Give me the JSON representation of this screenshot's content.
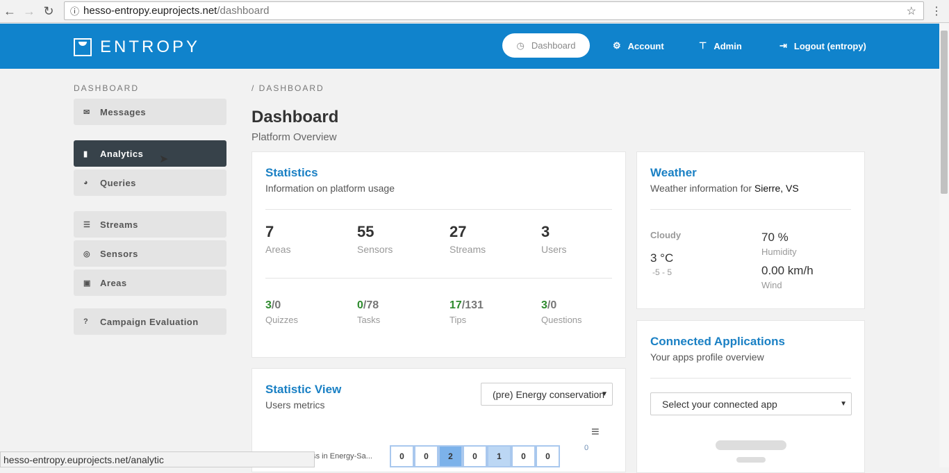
{
  "browser": {
    "url_host": "hesso-entropy.euprojects.net",
    "url_path": "/dashboard",
    "status_url": "hesso-entropy.euprojects.net/analytic"
  },
  "brand": {
    "name": "ENTROPY",
    "color": "#1083cc"
  },
  "nav": {
    "dashboard": "Dashboard",
    "account": "Account",
    "admin": "Admin",
    "logout": "Logout (entropy)"
  },
  "sidebar": {
    "heading": "DASHBOARD",
    "items": [
      {
        "label": "Messages",
        "icon": "envelope-open-icon"
      },
      {
        "label": "Analytics",
        "icon": "bar-chart-icon",
        "active": true
      },
      {
        "label": "Queries",
        "icon": "pie-chart-icon"
      },
      {
        "label": "Streams",
        "icon": "table-icon"
      },
      {
        "label": "Sensors",
        "icon": "target-icon"
      },
      {
        "label": "Areas",
        "icon": "map-icon"
      },
      {
        "label": "Campaign Evaluation",
        "icon": "question-icon"
      }
    ]
  },
  "page": {
    "breadcrumb": "/ DASHBOARD",
    "title": "Dashboard",
    "subtitle": "Platform Overview"
  },
  "statistics": {
    "title": "Statistics",
    "subtitle": "Information on platform usage",
    "counts": [
      {
        "value": "7",
        "label": "Areas"
      },
      {
        "value": "55",
        "label": "Sensors"
      },
      {
        "value": "27",
        "label": "Streams"
      },
      {
        "value": "3",
        "label": "Users"
      }
    ],
    "ratios": [
      {
        "a": "3",
        "b": "/0",
        "label": "Quizzes"
      },
      {
        "a": "0",
        "b": "/78",
        "label": "Tasks"
      },
      {
        "a": "17",
        "b": "/131",
        "label": "Tips"
      },
      {
        "a": "3",
        "b": "/0",
        "label": "Questions"
      }
    ]
  },
  "weather": {
    "title": "Weather",
    "subtitle_prefix": "Weather information for ",
    "location": "Sierre, VS",
    "condition": "Cloudy",
    "temp": "3 °C",
    "range": "-5 - 5",
    "humidity": "70 %",
    "humidity_label": "Humidity",
    "wind": "0.00 km/h",
    "wind_label": "Wind"
  },
  "statview": {
    "title": "Statistic View",
    "subtitle": "Users metrics",
    "selected": "(pre) Energy conservation",
    "row_label": "ess in Energy-Sa...",
    "cells": [
      "0",
      "0",
      "2",
      "0",
      "1",
      "0",
      "0"
    ],
    "scale_label": "0"
  },
  "apps": {
    "title": "Connected Applications",
    "subtitle": "Your apps profile overview",
    "select": "Select your connected app"
  }
}
